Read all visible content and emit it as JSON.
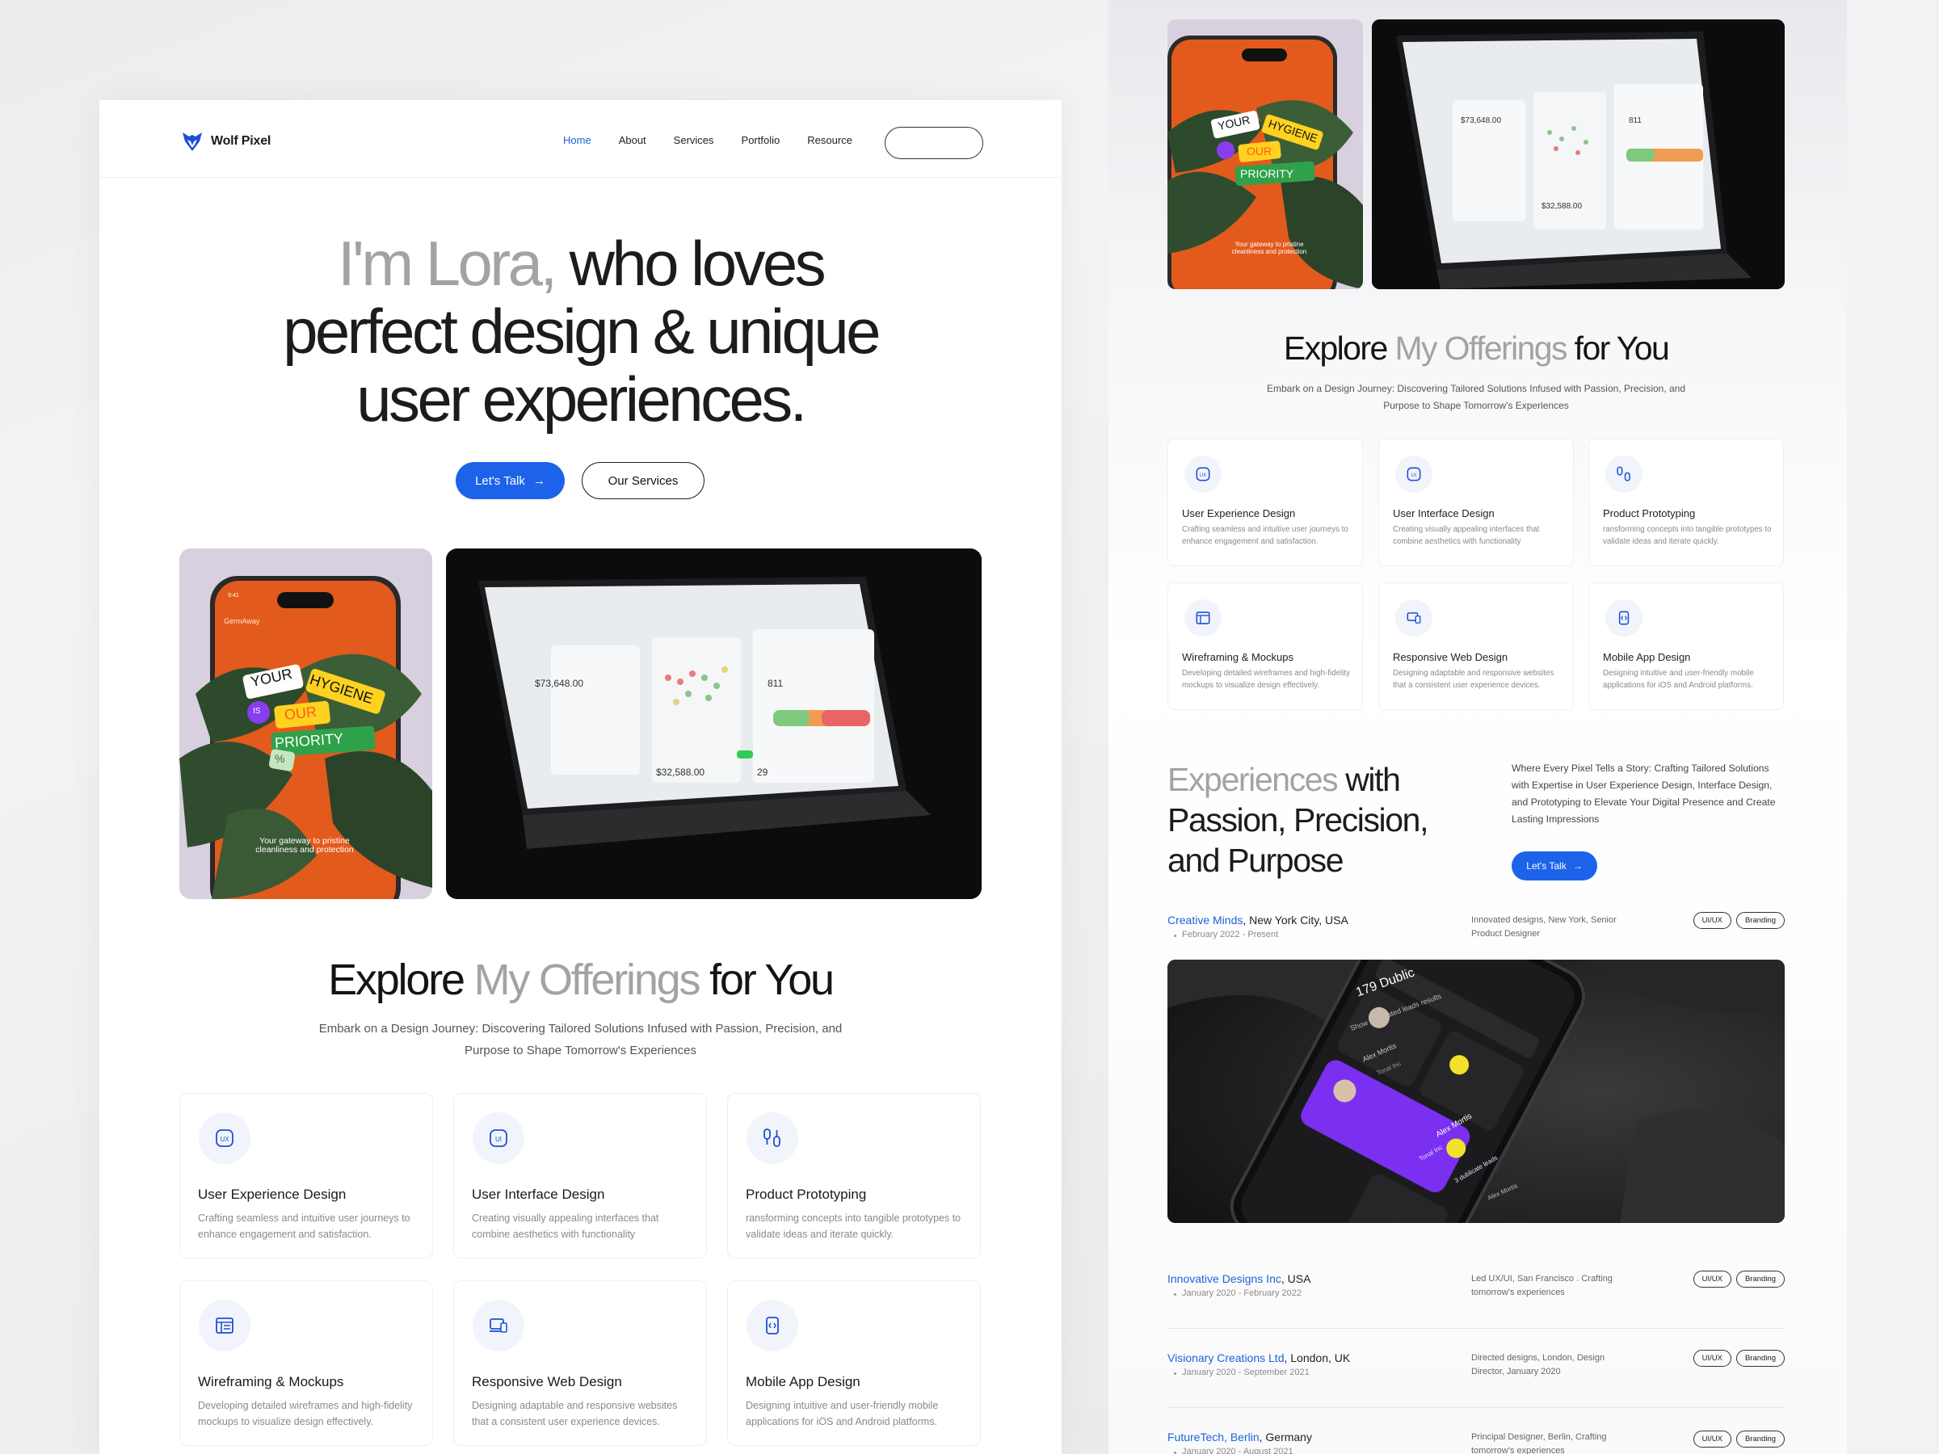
{
  "brand": {
    "name": "Wolf Pixel"
  },
  "nav": {
    "items": [
      "Home",
      "About",
      "Services",
      "Portfolio",
      "Resource"
    ],
    "active": "Home"
  },
  "hero": {
    "line1_grey": "I'm Lora,",
    "line1_dark": " who loves",
    "line2": "perfect design & unique",
    "line3": "user experiences.",
    "cta_primary": "Let's Talk",
    "cta_secondary": "Our Services"
  },
  "phone_mock": {
    "time": "9:41",
    "app": "GermAway",
    "stickers": [
      "YOUR",
      "HYGIENE",
      "IS",
      "OUR",
      "PRIORITY",
      "%"
    ],
    "tagline": "Your gateway to pristine cleanliness and protection"
  },
  "laptop_mock": {
    "values": [
      "$73,648.00",
      "$32,588.00",
      "811",
      "29"
    ]
  },
  "offerings": {
    "title_a": "Explore ",
    "title_grey": "My Offerings",
    "title_b": " for You",
    "subtitle_l1": "Embark on a Design Journey: Discovering Tailored Solutions Infused with Passion, Precision, and",
    "subtitle_l2": "Purpose to Shape Tomorrow's Experiences",
    "cards": [
      {
        "icon": "ux-icon",
        "title": "User Experience Design",
        "desc": "Crafting seamless and intuitive user journeys to enhance engagement and satisfaction."
      },
      {
        "icon": "ui-icon",
        "title": "User Interface Design",
        "desc": "Creating visually appealing interfaces that combine aesthetics with functionality"
      },
      {
        "icon": "prototype-icon",
        "title": "Product Prototyping",
        "desc": "ransforming concepts into tangible prototypes to validate ideas and iterate quickly."
      },
      {
        "icon": "wireframe-icon",
        "title": "Wireframing & Mockups",
        "desc": "Developing detailed wireframes and high-fidelity mockups to visualize design  effectively."
      },
      {
        "icon": "responsive-icon",
        "title": "Responsive Web Design",
        "desc": "Designing adaptable and responsive websites that a consistent user experience devices."
      },
      {
        "icon": "mobile-app-icon",
        "title": "Mobile App Design",
        "desc": "Designing intuitive and user-friendly mobile applications for iOS and Android platforms."
      }
    ]
  },
  "experience": {
    "title_grey": "Experiences",
    "title_l1_rest": " with",
    "title_l2": "Passion, Precision,",
    "title_l3": "and Purpose",
    "desc": "Where Every Pixel Tells a Story: Crafting Tailored Solutions with Expertise in User Experience Design, Interface Design, and Prototyping to Elevate Your Digital Presence and Create Lasting Impressions",
    "cta": "Let's Talk",
    "jobs": [
      {
        "company": "Creative Minds",
        "location": ", New York City, USA",
        "dates": "February 2022 - Present",
        "role": "Innovated designs, New York, Senior Product Designer",
        "tags": [
          "UI/UX",
          "Branding"
        ]
      },
      {
        "company": "Innovative Designs Inc",
        "location": ", USA",
        "dates": "January 2020 - February 2022",
        "role": "Led UX/UI, San Francisco . Crafting tomorrow's experiences",
        "tags": [
          "UI/UX",
          "Branding"
        ]
      },
      {
        "company": "Visionary Creations Ltd",
        "location": ", London, UK",
        "dates": "January 2020 - September 2021",
        "role": "Directed designs, London, Design Director, January 2020",
        "tags": [
          "UI/UX",
          "Branding"
        ]
      },
      {
        "company": "FutureTech, Berlin",
        "location": ", Germany",
        "dates": "January 2020 - August 2021",
        "role": "Principal Designer, Berlin, Crafting tomorrow's experiences",
        "tags": [
          "UI/UX",
          "Branding"
        ]
      }
    ]
  },
  "app_mock": {
    "header": "179 Dublic",
    "search": "Show dublicated leads results",
    "contacts": [
      "Alex Mortis",
      "Tonal Inc",
      "Alex Mortis",
      "Tonal Inc",
      "Alex Mortis"
    ],
    "leads": "3 dublicate leads"
  },
  "colors": {
    "accent": "#1d63ea",
    "grey_text": "#a3a3a6",
    "dark": "#141414"
  }
}
